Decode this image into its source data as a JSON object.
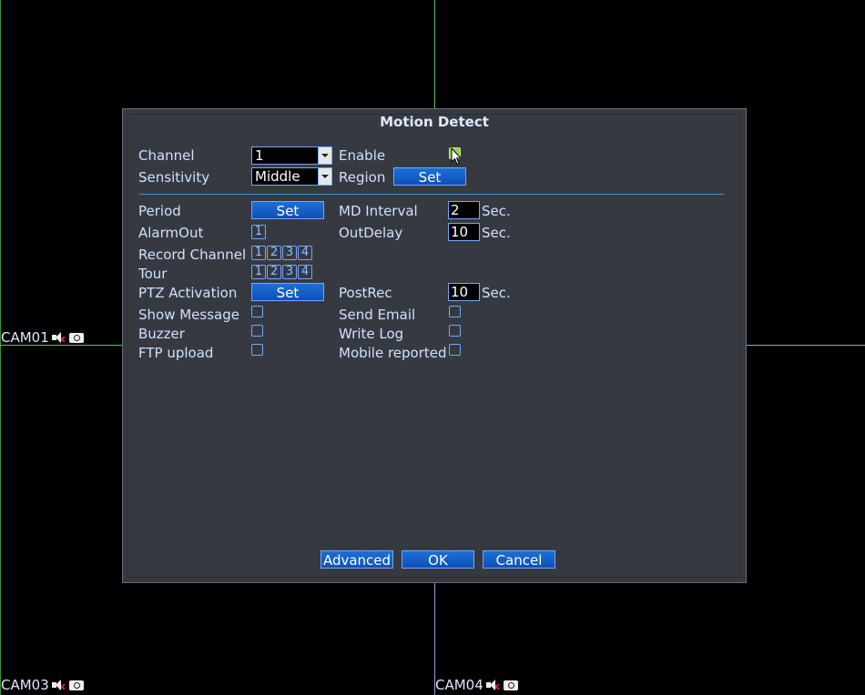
{
  "cameras": [
    "CAM01",
    "CAM03",
    "CAM04"
  ],
  "dialog": {
    "title": "Motion Detect",
    "channel_label": "Channel",
    "channel_value": "1",
    "enable_label": "Enable",
    "enable_checked": true,
    "sensitivity_label": "Sensitivity",
    "sensitivity_value": "Middle",
    "region_label": "Region",
    "region_button": "Set",
    "period_label": "Period",
    "period_button": "Set",
    "md_interval_label": "MD Interval",
    "md_interval_value": "2",
    "md_interval_unit": "Sec.",
    "alarmout_label": "AlarmOut",
    "alarmout_channels": [
      "1"
    ],
    "outdelay_label": "OutDelay",
    "outdelay_value": "10",
    "outdelay_unit": "Sec.",
    "record_channel_label": "Record Channel",
    "record_channels": [
      "1",
      "2",
      "3",
      "4"
    ],
    "tour_label": "Tour",
    "tour_channels": [
      "1",
      "2",
      "3",
      "4"
    ],
    "ptz_label": "PTZ Activation",
    "ptz_button": "Set",
    "postrec_label": "PostRec",
    "postrec_value": "10",
    "postrec_unit": "Sec.",
    "show_message_label": "Show Message",
    "send_email_label": "Send Email",
    "buzzer_label": "Buzzer",
    "write_log_label": "Write Log",
    "ftp_upload_label": "FTP upload",
    "mobile_reported_label": "Mobile reported",
    "advanced_button": "Advanced",
    "ok_button": "OK",
    "cancel_button": "Cancel"
  },
  "colors": {
    "accent": "#1d6fd8",
    "dialog_bg": "#363a40",
    "checked": "#9ad24a"
  }
}
